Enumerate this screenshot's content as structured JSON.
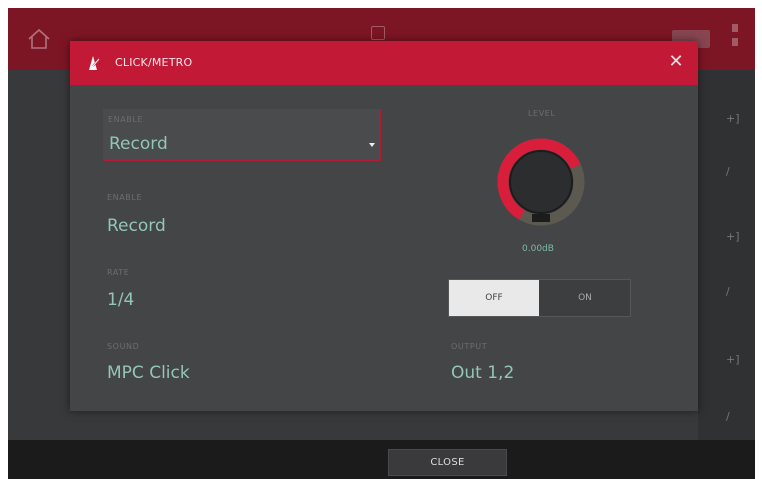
{
  "window": {
    "title": "CLICK/METRO",
    "close_glyph": "✕"
  },
  "fields": {
    "top_dropdown": {
      "label": "Enable",
      "value": "Record"
    },
    "enable": {
      "label": "Enable",
      "value": "Record"
    },
    "rate": {
      "label": "Rate",
      "value": "1/4"
    },
    "sound": {
      "label": "Sound",
      "value": "MPC Click"
    },
    "level": {
      "label": "Level",
      "value": "0.00dB",
      "knob_fraction": 0.72
    },
    "output": {
      "label": "Output",
      "value": "Out 1,2"
    }
  },
  "toggle": {
    "off_label": "OFF",
    "on_label": "ON",
    "selected": "OFF"
  },
  "footer": {
    "close_label": "CLOSE"
  },
  "icons": {
    "home": "home-icon",
    "metronome": "metronome-icon",
    "close": "close-icon",
    "caret": "caret-down-icon"
  },
  "colors": {
    "header": "#c21a36",
    "accent_text": "#92c7b4",
    "top_bar": "#7d1624"
  }
}
